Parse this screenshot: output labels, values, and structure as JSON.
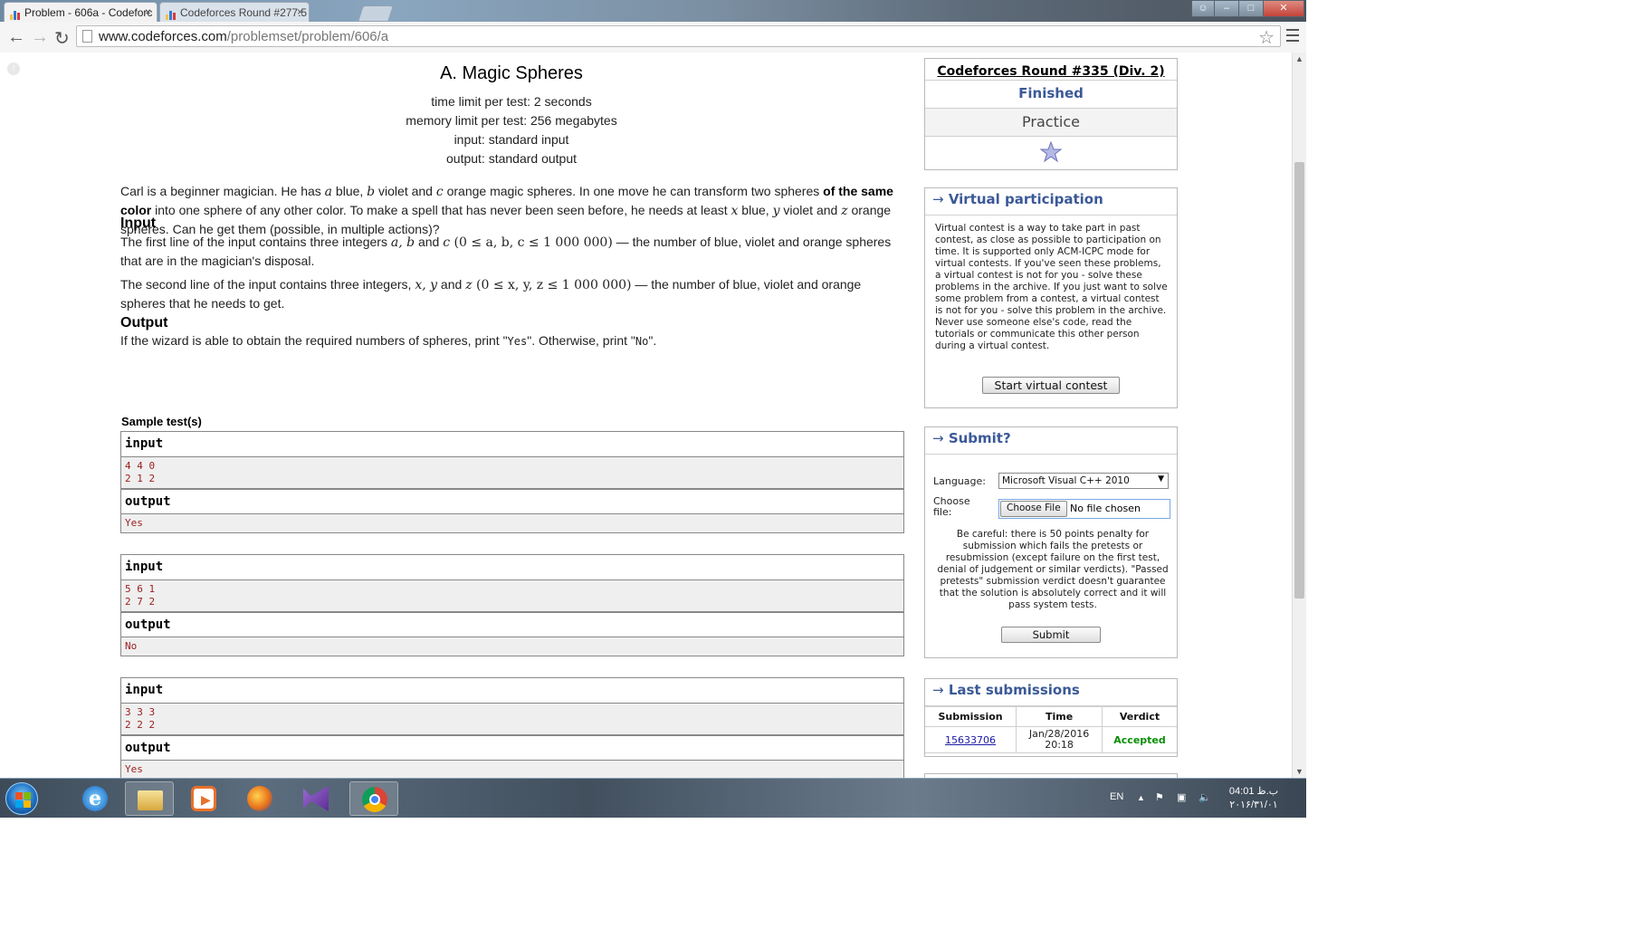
{
  "browser": {
    "tabs": [
      {
        "title": "Problem - 606a - Codeforc",
        "active": true
      },
      {
        "title": "Codeforces Round #277.5",
        "active": false
      }
    ],
    "url_host": "www.codeforces.com",
    "url_path": "/problemset/problem/606/a",
    "tab_close": "×"
  },
  "problem": {
    "title": "A. Magic Spheres",
    "time_limit": "time limit per test: 2 seconds",
    "memory_limit": "memory limit per test: 256 megabytes",
    "input_file": "input: standard input",
    "output_file": "output: standard output",
    "legend": {
      "p1": "Carl is a beginner magician. He has ",
      "v_a": "a",
      "p2": " blue, ",
      "v_b": "b",
      "p3": " violet and ",
      "v_c": "c",
      "p4": " orange magic spheres. In one move he can transform two spheres ",
      "bold": "of the same color",
      "p5": " into one sphere of any other color. To make a spell that has never been seen before, he needs at least ",
      "v_x": "x",
      "p6": " blue, ",
      "v_y": "y",
      "p7": " violet and ",
      "v_z": "z",
      "p8": " orange spheres. Can he get them (possible, in multiple actions)?"
    },
    "input_title": "Input",
    "input_line1": {
      "a": "The first line of the input contains three integers ",
      "vars": "a, b",
      "b": " and ",
      "var_c": "c",
      "math": " (0 ≤ a, b, c ≤ 1 000 000)",
      "c": " — the number of blue, violet and orange spheres that are in the magician's disposal."
    },
    "input_line2": {
      "a": "The second line of the input contains three integers, ",
      "vars": "x, y",
      "b": " and ",
      "var_z": "z",
      "math": " (0 ≤ x, y, z ≤ 1 000 000)",
      "c": " — the number of blue, violet and orange spheres that he needs to get."
    },
    "output_title": "Output",
    "output_text": {
      "a": "If the wizard is able to obtain the required numbers of spheres, print \"",
      "yes": "Yes",
      "b": "\". Otherwise, print \"",
      "no": "No",
      "c": "\"."
    },
    "sample_title": "Sample test(s)",
    "tests": [
      {
        "input_label": "input",
        "input": "4 4 0\n2 1 2",
        "output_label": "output",
        "output": "Yes"
      },
      {
        "input_label": "input",
        "input": "5 6 1\n2 7 2",
        "output_label": "output",
        "output": "No"
      },
      {
        "input_label": "input",
        "input": "3 3 3\n2 2 2",
        "output_label": "output",
        "output": "Yes"
      }
    ]
  },
  "sidebar": {
    "contest": {
      "name": "Codeforces Round #335 (Div. 2)",
      "status": "Finished",
      "mode": "Practice"
    },
    "virtual": {
      "title": "Virtual participation",
      "text": "Virtual contest is a way to take part in past contest, as close as possible to participation on time. It is supported only ACM-ICPC mode for virtual contests. If you've seen these problems, a virtual contest is not for you - solve these problems in the archive. If you just want to solve some problem from a contest, a virtual contest is not for you - solve this problem in the archive. Never use someone else's code, read the tutorials or communicate this other person during a virtual contest.",
      "button": "Start virtual contest"
    },
    "submit": {
      "title": "Submit?",
      "language_label": "Language:",
      "language_value": "Microsoft Visual C++ 2010",
      "file_label": "Choose file:",
      "file_button": "Choose File",
      "file_status": "No file chosen",
      "warning": "Be careful: there is 50 points penalty for submission which fails the pretests or resubmission (except failure on the first test, denial of judgement or similar verdicts). \"Passed pretests\" submission verdict doesn't guarantee that the solution is absolutely correct and it will pass system tests.",
      "button": "Submit"
    },
    "last": {
      "title": "Last submissions",
      "headers": [
        "Submission",
        "Time",
        "Verdict"
      ],
      "rows": [
        {
          "id": "15633706",
          "time_date": "Jan/28/2016",
          "time_clock": "20:18",
          "verdict": "Accepted"
        }
      ]
    },
    "arrow": "→"
  },
  "taskbar": {
    "lang": "EN",
    "time": "04:01 ب.ظ",
    "date": "٢٠١۶/٣١/٠١"
  },
  "colors": {
    "link_blue": "#3b5998",
    "accepted": "#0a8f08",
    "sample_text": "#9b1c1c"
  }
}
